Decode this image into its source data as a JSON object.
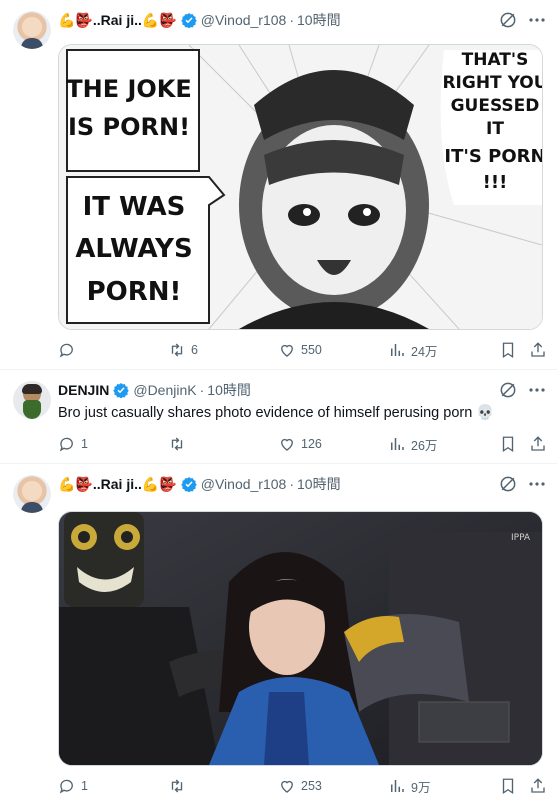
{
  "tweets": [
    {
      "author": {
        "name": "💪👺..Rai ji..💪👺",
        "handle": "@Vinod_r108",
        "time": "10時間",
        "verified": true,
        "avatar": "baby-avatar"
      },
      "text": "",
      "media": {
        "type": "manga-panel",
        "left_text": [
          "THE JOKE",
          "IS PORN!",
          "IT WAS",
          "ALWAYS",
          "PORN!"
        ],
        "right_text": [
          "THAT'S",
          "RIGHT YOU",
          "GUESSED",
          "IT",
          "IT'S PORN",
          "!!!"
        ]
      },
      "stats": {
        "replies": "",
        "retweets": "6",
        "likes": "550",
        "views": "24万"
      }
    },
    {
      "author": {
        "name": "DENJIN",
        "handle": "@DenjinK",
        "time": "10時間",
        "verified": true,
        "avatar": "beard-avatar"
      },
      "text": "Bro just casually shares photo evidence of himself perusing porn 💀",
      "stats": {
        "replies": "1",
        "retweets": "",
        "likes": "126",
        "views": "26万"
      }
    },
    {
      "author": {
        "name": "💪👺..Rai ji..💪👺",
        "handle": "@Vinod_r108",
        "time": "10時間",
        "verified": true,
        "avatar": "baby-avatar"
      },
      "text": "",
      "media": {
        "type": "photo",
        "watermark": "IPPA"
      },
      "stats": {
        "replies": "1",
        "retweets": "",
        "likes": "253",
        "views": "9万"
      }
    }
  ],
  "colors": {
    "text": "#0f1419",
    "secondary": "#536471",
    "verified": "#1d9bf0",
    "border": "#eff3f4"
  }
}
